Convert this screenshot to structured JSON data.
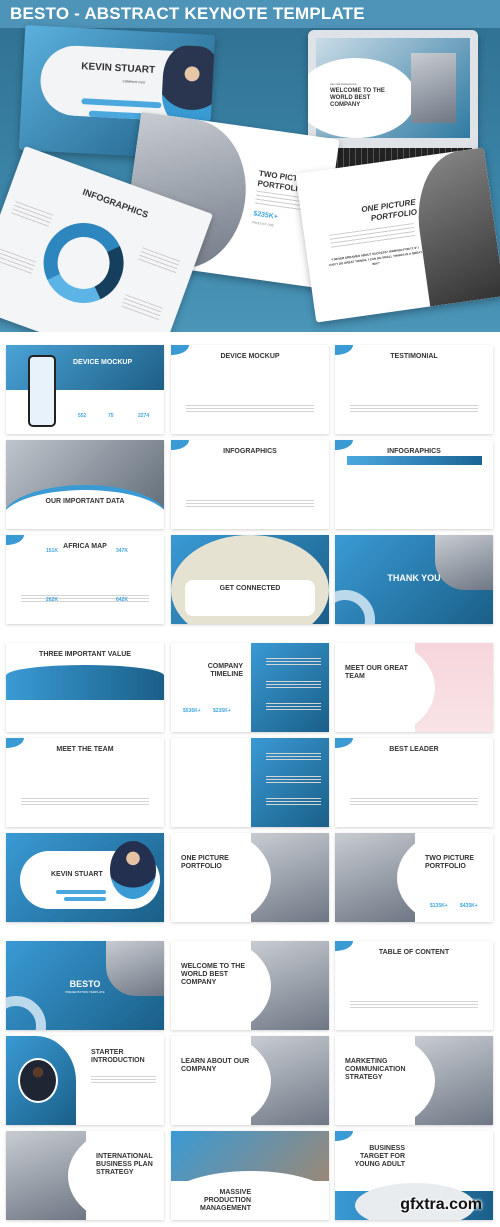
{
  "hero": {
    "title": "BESTO - ABSTRACT KEYNOTE TEMPLATE",
    "cards": {
      "kevin": {
        "title": "KEVIN STUART",
        "subtitle": "COMPANY CEO"
      },
      "welcome": {
        "kicker": "WELCOME PRESENTATION",
        "title": "WELCOME TO THE WORLD BEST COMPANY"
      },
      "two_picture": {
        "title": "TWO PICTURE PORTFOLIO",
        "stat": "$235K+",
        "stat_label": "PRODUCT ONE"
      },
      "one_picture": {
        "title": "ONE PICTURE PORTFOLIO",
        "quote": "\"I NEVER DREAMED ABOUT SUCCESS I WORKED FOR IT. IF I CAN'T DO GREAT THINGS, I CAN DO SMALL THINGS IN A GREAT WAY\""
      },
      "infographics": {
        "title": "INFOGRAPHICS"
      }
    }
  },
  "sections": [
    [
      {
        "style": "blue-top",
        "title": "DEVICE MOCKUP",
        "stats": [
          "552",
          "75",
          "2274"
        ]
      },
      {
        "style": "white",
        "title": "DEVICE MOCKUP"
      },
      {
        "style": "white",
        "title": "TESTIMONIAL"
      },
      {
        "style": "photo-bottom",
        "title": "OUR IMPORTANT DATA"
      },
      {
        "style": "white",
        "title": "INFOGRAPHICS"
      },
      {
        "style": "white-arrows",
        "title": "INFOGRAPHICS"
      },
      {
        "style": "white",
        "title": "AFRICA MAP",
        "stats": [
          "151K",
          "347K",
          "262K",
          "642K"
        ]
      },
      {
        "style": "map",
        "title": "GET CONNECTED"
      },
      {
        "style": "blue",
        "title": "THANK YOU"
      }
    ],
    [
      {
        "style": "white-wave",
        "title": "THREE IMPORTANT VALUE"
      },
      {
        "style": "half-blue",
        "title": "COMPANY TIMELINE",
        "stats": [
          "$536K+",
          "$235K+"
        ]
      },
      {
        "style": "photo-right-pink",
        "title": "MEET OUR GREAT TEAM"
      },
      {
        "style": "white",
        "title": "MEET THE TEAM"
      },
      {
        "style": "half-blue",
        "title": ""
      },
      {
        "style": "white",
        "title": "BEST LEADER"
      },
      {
        "style": "blue-pill",
        "title": "KEVIN STUART"
      },
      {
        "style": "photo-right",
        "title": "ONE PICTURE PORTFOLIO"
      },
      {
        "style": "photo-left",
        "title": "TWO PICTURE PORTFOLIO",
        "stats": [
          "$135K+",
          "$435K+"
        ]
      }
    ],
    [
      {
        "style": "blue",
        "title": "BESTO",
        "subtitle": "PRESENTATION TEMPLATE"
      },
      {
        "style": "photo-right",
        "title": "WELCOME TO THE WORLD BEST COMPANY"
      },
      {
        "style": "white",
        "title": "TABLE OF CONTENT"
      },
      {
        "style": "blue-left",
        "title": "STARTER INTRODUCTION"
      },
      {
        "style": "photo-right",
        "title": "LEARN ABOUT OUR COMPANY"
      },
      {
        "style": "photo-right",
        "title": "MARKETING COMMUNICATION STRATEGY"
      },
      {
        "style": "photo-left",
        "title": "INTERNATIONAL BUSINESS PLAN STRATEGY"
      },
      {
        "style": "photo-top",
        "title": "MASSIVE PRODUCTION MANAGEMENT"
      },
      {
        "style": "white-bottom",
        "title": "BUSINESS TARGET FOR YOUNG ADULT"
      }
    ]
  ],
  "watermark": "gfxtra.com",
  "colors": {
    "accent": "#3ea6e0",
    "dark_blue": "#1a5f88",
    "hero_bg": "#3c86aa"
  }
}
